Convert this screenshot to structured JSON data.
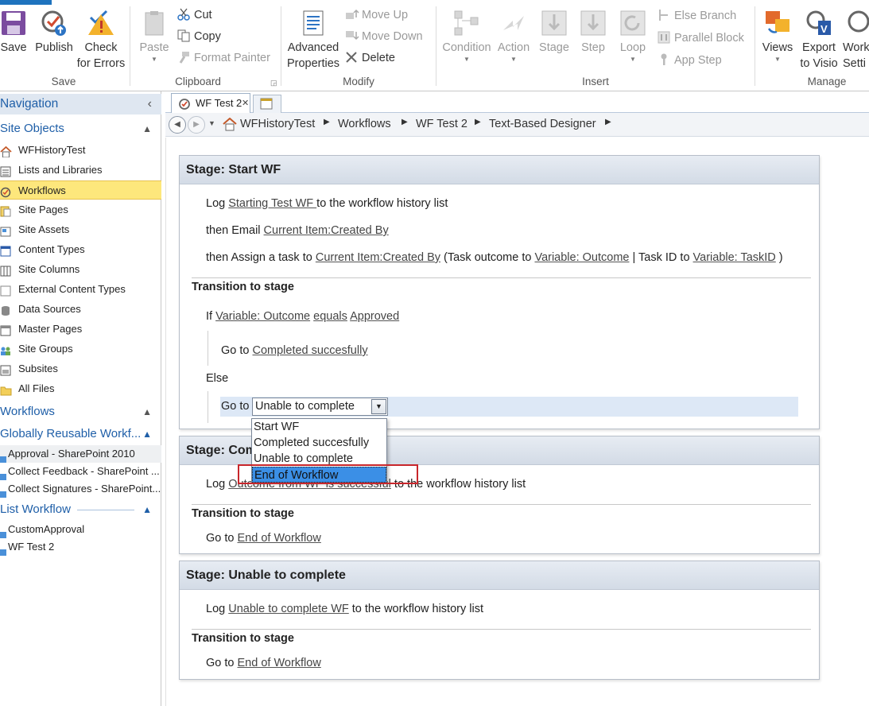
{
  "ribbon": {
    "save": "Save",
    "publish": "Publish",
    "check1": "Check",
    "check2": "for Errors",
    "paste": "Paste",
    "cut": "Cut",
    "copy": "Copy",
    "format_painter": "Format Painter",
    "adv1": "Advanced",
    "adv2": "Properties",
    "move_up": "Move Up",
    "move_down": "Move Down",
    "delete": "Delete",
    "condition": "Condition",
    "action": "Action",
    "stage": "Stage",
    "step": "Step",
    "loop": "Loop",
    "else_branch": "Else Branch",
    "parallel_block": "Parallel Block",
    "app_step": "App Step",
    "views": "Views",
    "export1": "Export",
    "export2": "to Visio",
    "wset1": "Work",
    "wset2": "Setti",
    "groups": {
      "save": "Save",
      "clipboard": "Clipboard",
      "modify": "Modify",
      "insert": "Insert",
      "manage": "Manage"
    }
  },
  "tabs": {
    "active": "WF Test 2"
  },
  "breadcrumb": [
    "WFHistoryTest",
    "Workflows",
    "WF Test 2",
    "Text-Based Designer"
  ],
  "nav": {
    "title": "Navigation",
    "site_objects": "Site Objects",
    "items": [
      "WFHistoryTest",
      "Lists and Libraries",
      "Workflows",
      "Site Pages",
      "Site Assets",
      "Content Types",
      "Site Columns",
      "External Content Types",
      "Data Sources",
      "Master Pages",
      "Site Groups",
      "Subsites",
      "All Files"
    ],
    "workflows": "Workflows",
    "global": "Globally Reusable Workf...",
    "global_items": [
      "Approval - SharePoint 2010",
      "Collect Feedback - SharePoint ...",
      "Collect Signatures - SharePoint..."
    ],
    "list_wf": "List Workflow",
    "list_items": [
      "CustomApproval",
      "WF Test 2"
    ]
  },
  "stage1": {
    "title": "Stage: Start WF",
    "log_pre": "Log ",
    "log_link": "Starting Test WF ",
    "log_post": " to the workflow history list",
    "email_pre": "then Email ",
    "email_link": "Current Item:Created By",
    "assign_pre": "then Assign a task to ",
    "assign_link": "Current Item:Created By",
    "assign_mid1": " (Task outcome to ",
    "assign_link2": "Variable: Outcome",
    "assign_mid2": " | Task ID to ",
    "assign_link3": "Variable: TaskID",
    "assign_end": " )",
    "transition": "Transition to stage",
    "if_pre": "If ",
    "if_var": "Variable: Outcome",
    "if_op": "equals",
    "if_val": "Approved",
    "goto": "Go to ",
    "goto_target": "Completed succesfully",
    "else": "Else",
    "goto2": "Go to",
    "combo_value": "Unable to complete"
  },
  "dropdown": {
    "options": [
      "Start WF",
      "Completed succesfully",
      "Unable to complete",
      "End of Workflow"
    ],
    "selected": "End of Workflow"
  },
  "stage2": {
    "title": "Stage: Completed succesfully",
    "log_pre": "Log ",
    "log_link": "Outcome from WF is successful",
    "log_post": " to the workflow history list",
    "transition": "Transition to stage",
    "goto": "Go to ",
    "goto_target": "End of Workflow"
  },
  "stage3": {
    "title": "Stage: Unable to complete",
    "log_pre": "Log ",
    "log_link": "Unable to complete WF",
    "log_post": " to the workflow history list",
    "transition": "Transition to stage",
    "goto": "Go to ",
    "goto_target": "End of Workflow"
  },
  "colors": {
    "accent": "#1f5fa8",
    "selection": "#fde77c",
    "highlight": "#c8262b"
  }
}
